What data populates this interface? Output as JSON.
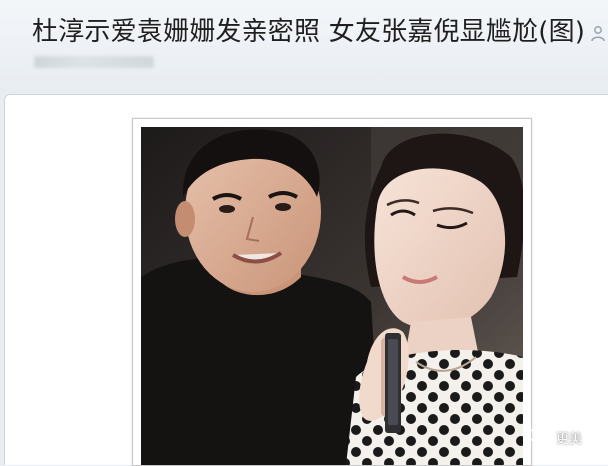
{
  "post": {
    "title": "杜淳示爱袁姗姗发亲密照 女友张嘉倪显尴尬(图)",
    "author_icon": "user-icon",
    "meta_hidden": true
  },
  "photo": {
    "description_icon": "photo-image"
  },
  "watermark": {
    "logo_icon": "wechat-logo-icon",
    "label": "更美"
  },
  "colors": {
    "header_bg": "#e9edf2",
    "panel_bg": "#ffffff",
    "title_text": "#1f1f1f"
  }
}
